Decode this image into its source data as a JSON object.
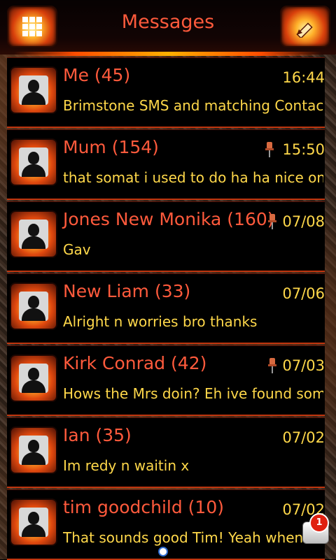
{
  "header": {
    "title": "Messages",
    "menu_icon": "grid-icon",
    "compose_icon": "pencil-icon"
  },
  "conversations": [
    {
      "name": "Me (45)",
      "time": "16:44",
      "pinned": false,
      "snippet": "Brimstone SMS and matching Contacts"
    },
    {
      "name": "Mum (154)",
      "time": "15:50",
      "pinned": true,
      "snippet": "that somat i used to do ha ha nice one ..."
    },
    {
      "name": "Jones New Monika (160)",
      "time": "07/08",
      "pinned": true,
      "snippet": "Gav"
    },
    {
      "name": "New Liam (33)",
      "time": "07/06",
      "pinned": false,
      "snippet": "Alright n worries bro thanks"
    },
    {
      "name": "Kirk Conrad (42)",
      "time": "07/03",
      "pinned": true,
      "snippet": "Hows the Mrs doin? Eh ive found some..."
    },
    {
      "name": "Ian (35)",
      "time": "07/02",
      "pinned": false,
      "snippet": "Im redy n waitin x"
    },
    {
      "name": "tim goodchild (10)",
      "time": "07/02",
      "pinned": false,
      "snippet": "That sounds good Tim! Yeah when the"
    }
  ],
  "notification": {
    "count": "1",
    "icon": "chat-bubble-icon"
  },
  "colors": {
    "name": "#ff5a3c",
    "text": "#ffd84a",
    "divider": "#c0350e"
  }
}
